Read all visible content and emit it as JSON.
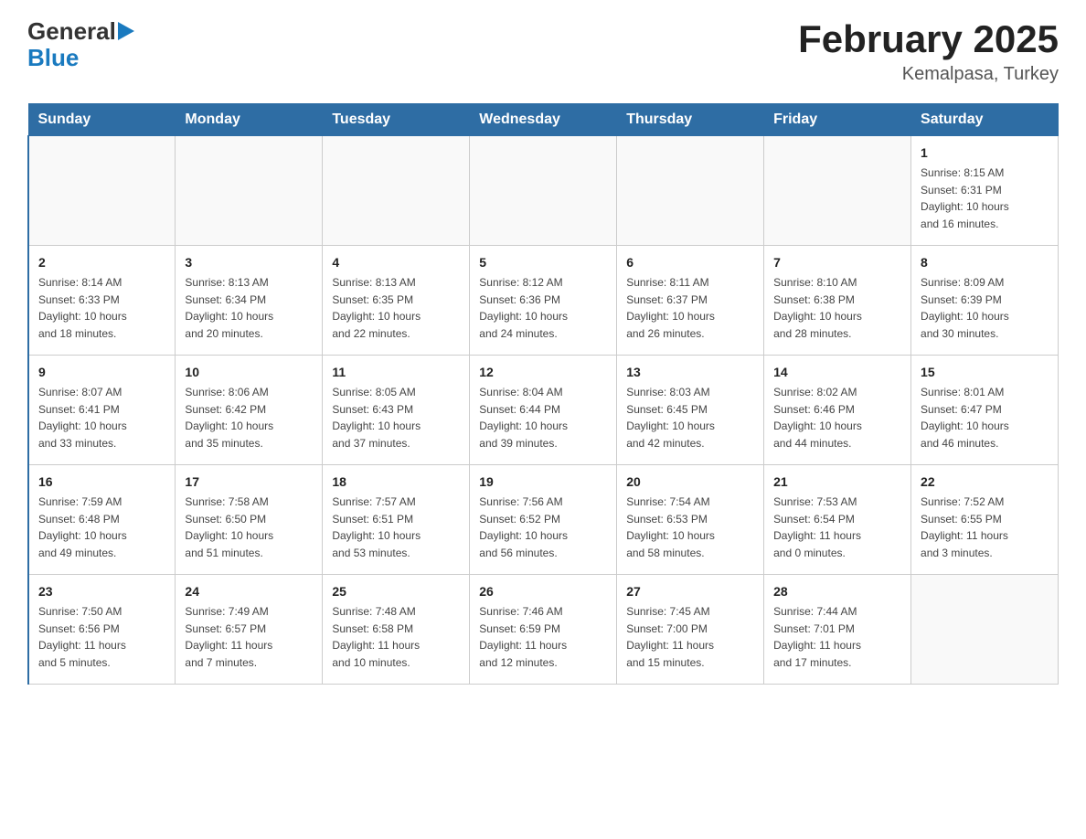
{
  "logo": {
    "general": "General",
    "blue": "Blue",
    "arrow": "▶"
  },
  "title": "February 2025",
  "subtitle": "Kemalpasa, Turkey",
  "days_of_week": [
    "Sunday",
    "Monday",
    "Tuesday",
    "Wednesday",
    "Thursday",
    "Friday",
    "Saturday"
  ],
  "weeks": [
    [
      {
        "day": "",
        "info": ""
      },
      {
        "day": "",
        "info": ""
      },
      {
        "day": "",
        "info": ""
      },
      {
        "day": "",
        "info": ""
      },
      {
        "day": "",
        "info": ""
      },
      {
        "day": "",
        "info": ""
      },
      {
        "day": "1",
        "info": "Sunrise: 8:15 AM\nSunset: 6:31 PM\nDaylight: 10 hours\nand 16 minutes."
      }
    ],
    [
      {
        "day": "2",
        "info": "Sunrise: 8:14 AM\nSunset: 6:33 PM\nDaylight: 10 hours\nand 18 minutes."
      },
      {
        "day": "3",
        "info": "Sunrise: 8:13 AM\nSunset: 6:34 PM\nDaylight: 10 hours\nand 20 minutes."
      },
      {
        "day": "4",
        "info": "Sunrise: 8:13 AM\nSunset: 6:35 PM\nDaylight: 10 hours\nand 22 minutes."
      },
      {
        "day": "5",
        "info": "Sunrise: 8:12 AM\nSunset: 6:36 PM\nDaylight: 10 hours\nand 24 minutes."
      },
      {
        "day": "6",
        "info": "Sunrise: 8:11 AM\nSunset: 6:37 PM\nDaylight: 10 hours\nand 26 minutes."
      },
      {
        "day": "7",
        "info": "Sunrise: 8:10 AM\nSunset: 6:38 PM\nDaylight: 10 hours\nand 28 minutes."
      },
      {
        "day": "8",
        "info": "Sunrise: 8:09 AM\nSunset: 6:39 PM\nDaylight: 10 hours\nand 30 minutes."
      }
    ],
    [
      {
        "day": "9",
        "info": "Sunrise: 8:07 AM\nSunset: 6:41 PM\nDaylight: 10 hours\nand 33 minutes."
      },
      {
        "day": "10",
        "info": "Sunrise: 8:06 AM\nSunset: 6:42 PM\nDaylight: 10 hours\nand 35 minutes."
      },
      {
        "day": "11",
        "info": "Sunrise: 8:05 AM\nSunset: 6:43 PM\nDaylight: 10 hours\nand 37 minutes."
      },
      {
        "day": "12",
        "info": "Sunrise: 8:04 AM\nSunset: 6:44 PM\nDaylight: 10 hours\nand 39 minutes."
      },
      {
        "day": "13",
        "info": "Sunrise: 8:03 AM\nSunset: 6:45 PM\nDaylight: 10 hours\nand 42 minutes."
      },
      {
        "day": "14",
        "info": "Sunrise: 8:02 AM\nSunset: 6:46 PM\nDaylight: 10 hours\nand 44 minutes."
      },
      {
        "day": "15",
        "info": "Sunrise: 8:01 AM\nSunset: 6:47 PM\nDaylight: 10 hours\nand 46 minutes."
      }
    ],
    [
      {
        "day": "16",
        "info": "Sunrise: 7:59 AM\nSunset: 6:48 PM\nDaylight: 10 hours\nand 49 minutes."
      },
      {
        "day": "17",
        "info": "Sunrise: 7:58 AM\nSunset: 6:50 PM\nDaylight: 10 hours\nand 51 minutes."
      },
      {
        "day": "18",
        "info": "Sunrise: 7:57 AM\nSunset: 6:51 PM\nDaylight: 10 hours\nand 53 minutes."
      },
      {
        "day": "19",
        "info": "Sunrise: 7:56 AM\nSunset: 6:52 PM\nDaylight: 10 hours\nand 56 minutes."
      },
      {
        "day": "20",
        "info": "Sunrise: 7:54 AM\nSunset: 6:53 PM\nDaylight: 10 hours\nand 58 minutes."
      },
      {
        "day": "21",
        "info": "Sunrise: 7:53 AM\nSunset: 6:54 PM\nDaylight: 11 hours\nand 0 minutes."
      },
      {
        "day": "22",
        "info": "Sunrise: 7:52 AM\nSunset: 6:55 PM\nDaylight: 11 hours\nand 3 minutes."
      }
    ],
    [
      {
        "day": "23",
        "info": "Sunrise: 7:50 AM\nSunset: 6:56 PM\nDaylight: 11 hours\nand 5 minutes."
      },
      {
        "day": "24",
        "info": "Sunrise: 7:49 AM\nSunset: 6:57 PM\nDaylight: 11 hours\nand 7 minutes."
      },
      {
        "day": "25",
        "info": "Sunrise: 7:48 AM\nSunset: 6:58 PM\nDaylight: 11 hours\nand 10 minutes."
      },
      {
        "day": "26",
        "info": "Sunrise: 7:46 AM\nSunset: 6:59 PM\nDaylight: 11 hours\nand 12 minutes."
      },
      {
        "day": "27",
        "info": "Sunrise: 7:45 AM\nSunset: 7:00 PM\nDaylight: 11 hours\nand 15 minutes."
      },
      {
        "day": "28",
        "info": "Sunrise: 7:44 AM\nSunset: 7:01 PM\nDaylight: 11 hours\nand 17 minutes."
      },
      {
        "day": "",
        "info": ""
      }
    ]
  ]
}
